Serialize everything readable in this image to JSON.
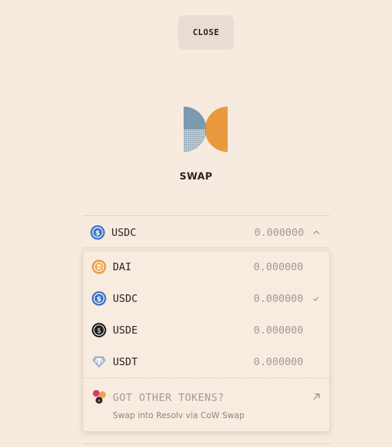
{
  "header": {
    "close_label": "CLOSE"
  },
  "title": "SWAP",
  "selected": {
    "symbol": "USDC",
    "balance": "0.000000",
    "icon": "usdc-icon"
  },
  "tokens": [
    {
      "symbol": "DAI",
      "balance": "0.000000",
      "icon": "dai-icon",
      "selected": false
    },
    {
      "symbol": "USDC",
      "balance": "0.000000",
      "icon": "usdc-icon",
      "selected": true
    },
    {
      "symbol": "USDE",
      "balance": "0.000000",
      "icon": "usde-icon",
      "selected": false
    },
    {
      "symbol": "USDT",
      "balance": "0.000000",
      "icon": "usdt-icon",
      "selected": false
    }
  ],
  "other_tokens": {
    "title": "GOT OTHER TOKENS?",
    "subtitle": "Swap into Resolv via CoW Swap"
  },
  "colors": {
    "background": "#f7ebe0",
    "button_bg": "#e8ddd2",
    "logo_blue": "#7b9bb0",
    "logo_orange": "#e89a3c",
    "usdc": "#3d74c4",
    "dai": "#eda34a",
    "usde": "#1f1f1f",
    "usdt": "#a7b6c4",
    "muted_text": "#a49a91"
  }
}
